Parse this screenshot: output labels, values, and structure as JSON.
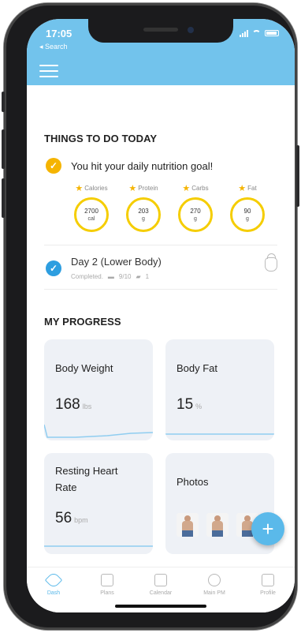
{
  "status_bar": {
    "time": "17:05",
    "back_label": "◂ Search"
  },
  "today": {
    "title": "THINGS TO DO TODAY",
    "goal_text": "You hit your daily nutrition goal!",
    "macros": [
      {
        "label": "Calories",
        "value": "2700",
        "unit": "cal"
      },
      {
        "label": "Protein",
        "value": "203",
        "unit": "g"
      },
      {
        "label": "Carbs",
        "value": "270",
        "unit": "g"
      },
      {
        "label": "Fat",
        "value": "90",
        "unit": "g"
      }
    ],
    "workout": {
      "title": "Day 2 (Lower Body)",
      "status": "Completed.",
      "sets": "9/10",
      "comments": "1"
    }
  },
  "progress": {
    "title": "MY PROGRESS",
    "cards": [
      {
        "title": "Body Weight",
        "value": "168",
        "unit": "lbs"
      },
      {
        "title": "Body Fat",
        "value": "15",
        "unit": "%"
      },
      {
        "title": "Resting Heart Rate",
        "value": "56",
        "unit": "bpm"
      },
      {
        "title": "Photos"
      }
    ]
  },
  "fab_label": "+",
  "tabs": [
    {
      "label": "Dash",
      "active": true
    },
    {
      "label": "Plans"
    },
    {
      "label": "Calendar"
    },
    {
      "label": "Main PM"
    },
    {
      "label": "Profile"
    }
  ],
  "colors": {
    "accent": "#5ab9ea",
    "header": "#72c3ec",
    "goal": "#f5b400",
    "ring": "#f5cd00"
  }
}
